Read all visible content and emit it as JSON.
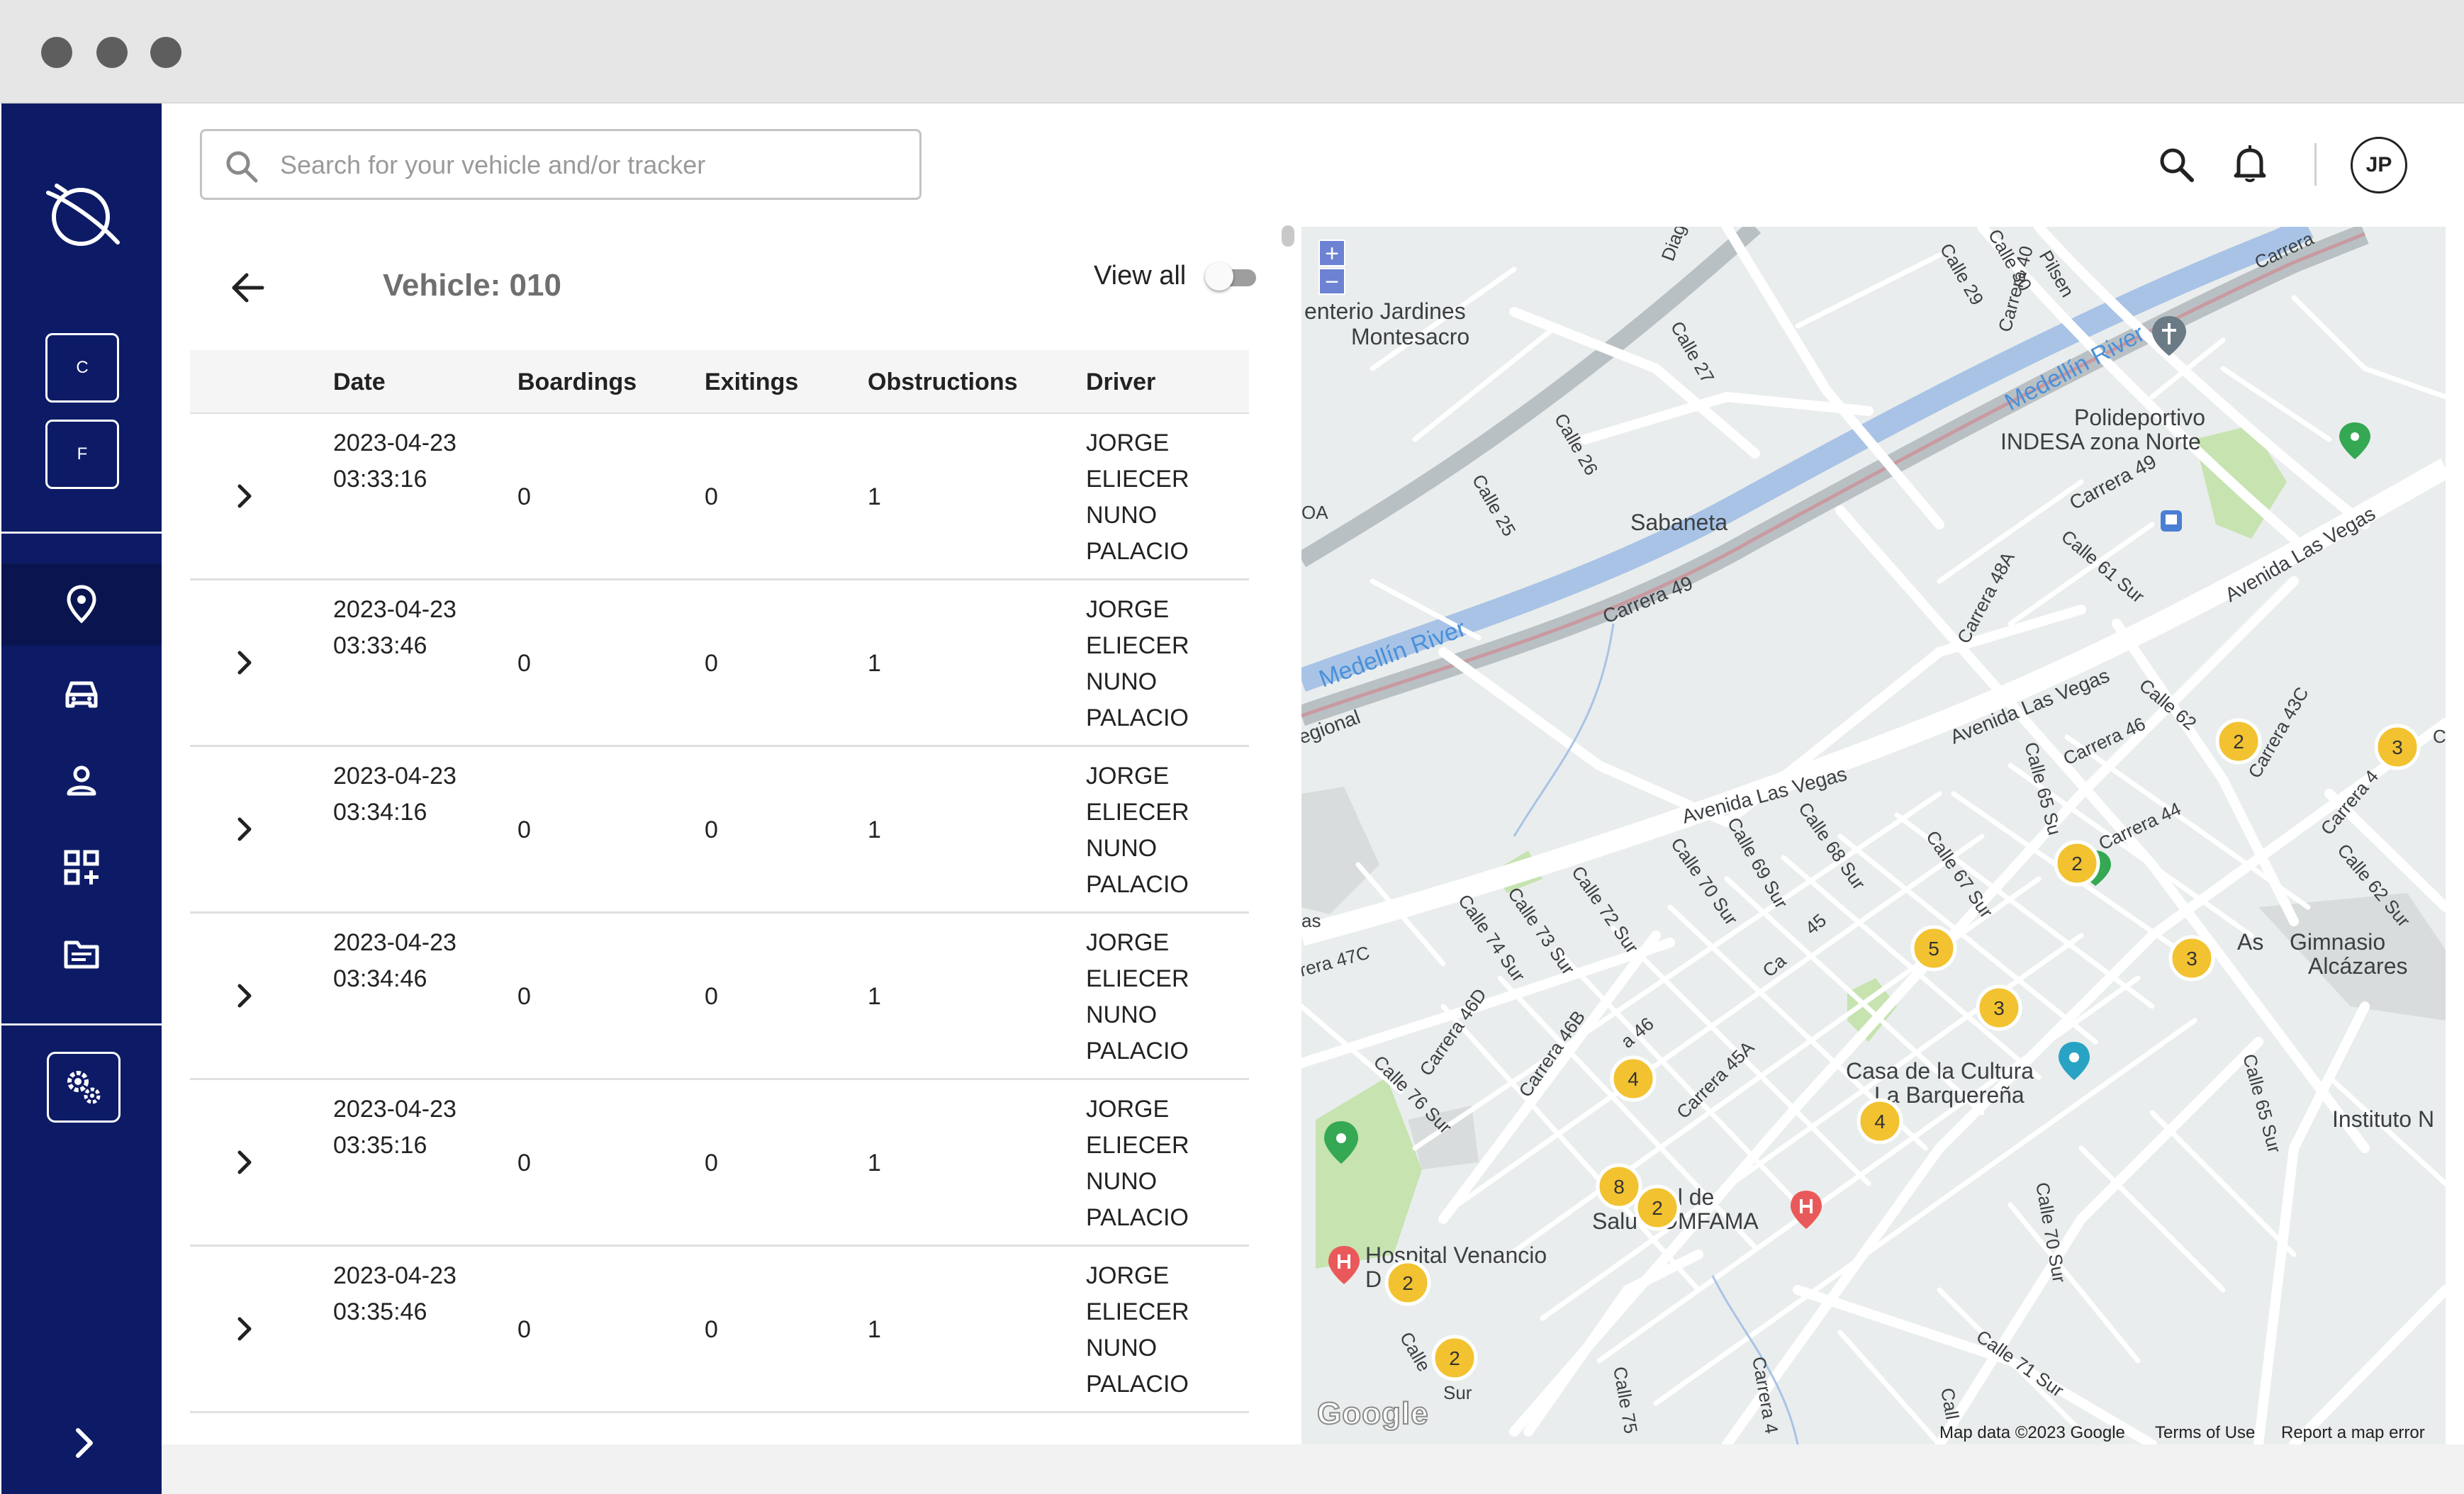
{
  "search": {
    "placeholder": "Search for your vehicle and/or tracker"
  },
  "sidebar": {
    "buttons": [
      {
        "label": "C"
      },
      {
        "label": "F"
      }
    ],
    "nav_icons": [
      "location-pin-icon",
      "car-icon",
      "user-icon",
      "dashboard-add-icon",
      "document-icon"
    ],
    "settings_icon": "gears-icon",
    "expand_icon": "chevron-right-icon"
  },
  "header": {
    "avatar_initials": "JP",
    "icons": [
      "search-icon",
      "bell-icon"
    ]
  },
  "panel": {
    "title": "Vehicle: 010",
    "view_all_label": "View all",
    "view_all_enabled": false
  },
  "table": {
    "columns": [
      "Date",
      "Boardings",
      "Exitings",
      "Obstructions",
      "Driver"
    ],
    "rows": [
      {
        "date": "2023-04-23 03:33:16",
        "boardings": "0",
        "exitings": "0",
        "obstructions": "1",
        "driver": "JORGE ELIECER NUNO PALACIO"
      },
      {
        "date": "2023-04-23 03:33:46",
        "boardings": "0",
        "exitings": "0",
        "obstructions": "1",
        "driver": "JORGE ELIECER NUNO PALACIO"
      },
      {
        "date": "2023-04-23 03:34:16",
        "boardings": "0",
        "exitings": "0",
        "obstructions": "1",
        "driver": "JORGE ELIECER NUNO PALACIO"
      },
      {
        "date": "2023-04-23 03:34:46",
        "boardings": "0",
        "exitings": "0",
        "obstructions": "1",
        "driver": "JORGE ELIECER NUNO PALACIO"
      },
      {
        "date": "2023-04-23 03:35:16",
        "boardings": "0",
        "exitings": "0",
        "obstructions": "1",
        "driver": "JORGE ELIECER NUNO PALACIO"
      },
      {
        "date": "2023-04-23 03:35:46",
        "boardings": "0",
        "exitings": "0",
        "obstructions": "1",
        "driver": "JORGE ELIECER NUNO PALACIO"
      }
    ]
  },
  "map": {
    "zoom_in": "+",
    "zoom_out": "−",
    "google_logo": "Google",
    "footer": {
      "map_data": "Map data ©2023 Google",
      "terms": "Terms of Use",
      "report": "Report a map error"
    },
    "labels": {
      "jardines1": "enterio Jardines",
      "jardines2": "Montesacro",
      "river_top": "Medellín River",
      "river_bottom": "Medellín River",
      "poli1": "Polideportivo",
      "poli2": "INDESA zona Norte",
      "sabaneta": "Sabaneta",
      "carrera49a": "Carrera 49",
      "carrera49b": "Carrera 49",
      "vegas1": "Avenida Las Vegas",
      "vegas2": "Avenida Las Vegas",
      "vegas3": "Avenida Las Vegas",
      "gimnasio1": "Gimnasio",
      "gimnasio2": "Alcázares",
      "cultura1": "Casa de la Cultura",
      "cultura2": "La Barquereña",
      "instituto": "Instituto N",
      "comfama1": "ntegral de",
      "comfama2": "Salu  COMFAMA",
      "hospital1": "Hospital Venancio",
      "hospital2": "D    íaz",
      "regional": "egional",
      "carrera47c": "rera 47C",
      "oa": "OA",
      "as": "as",
      "c": "C",
      "pilsen": "Pilsen",
      "carrera_top": "Carrera",
      "calle30": "Calle 30",
      "calle29": "Calle 29",
      "carrera40": "Carrera 40",
      "calle27": "Calle 27",
      "calle26": "Calle 26",
      "calle25": "Calle 25",
      "dia": "Diag",
      "calle61": "Calle 61 Sur",
      "carrera48a": "Carrera 48A",
      "calle62": "Calle 62",
      "carrera46": "Carrera 46",
      "carrera43c": "Carrera 43C",
      "calle65": "Calle 65 Su",
      "carrera44": "Carrera 44",
      "carrera4": "Carrera 4",
      "calle62sur": "Calle 62 Sur",
      "calle67": "Calle 67 Sur",
      "calle68": "Calle 68 Sur",
      "calle69": "Calle 69 Sur",
      "calle70": "Calle 70 Sur",
      "calle72": "Calle 72 Sur",
      "calle73": "Calle 73 Sur",
      "calle74": "Calle 74 Sur",
      "carrera46d": "Carrera 46D",
      "carrera46b": "Carrera 46B",
      "calle76": "Calle 76 Sur",
      "carrera45a": "Carrera 45A",
      "a46": "a 46",
      "n45": "45",
      "ca": "Ca",
      "as_": "As",
      "calle65s": "Calle 65 Sur",
      "calle70s": "Calle 70 Sur",
      "calle71": "Calle 71 Sur",
      "calle75": "Calle 75",
      "carrera4b": "Carrera 4",
      "call": "Call",
      "calle_sur": "Calle",
      "sur": "Sur"
    },
    "clusters": [
      {
        "count": "2",
        "color": "#f2c230"
      },
      {
        "count": "3",
        "color": "#f2c230"
      },
      {
        "count": "2",
        "color": "#f2c230"
      },
      {
        "count": "3",
        "color": "#f2c230"
      },
      {
        "count": "5",
        "color": "#f2c230"
      },
      {
        "count": "3",
        "color": "#f2c230"
      },
      {
        "count": "4",
        "color": "#f2c230"
      },
      {
        "count": "4",
        "color": "#f2c230"
      },
      {
        "count": "8",
        "color": "#f2c230"
      },
      {
        "count": "2",
        "color": "#f2c230"
      },
      {
        "count": "2",
        "color": "#f2c230"
      },
      {
        "count": "2",
        "color": "#f2c230"
      }
    ]
  },
  "colors": {
    "sidebar": "#0d1b66",
    "river": "#a8c3e6",
    "park": "#c6e3b0",
    "cluster": "#f2c230"
  }
}
